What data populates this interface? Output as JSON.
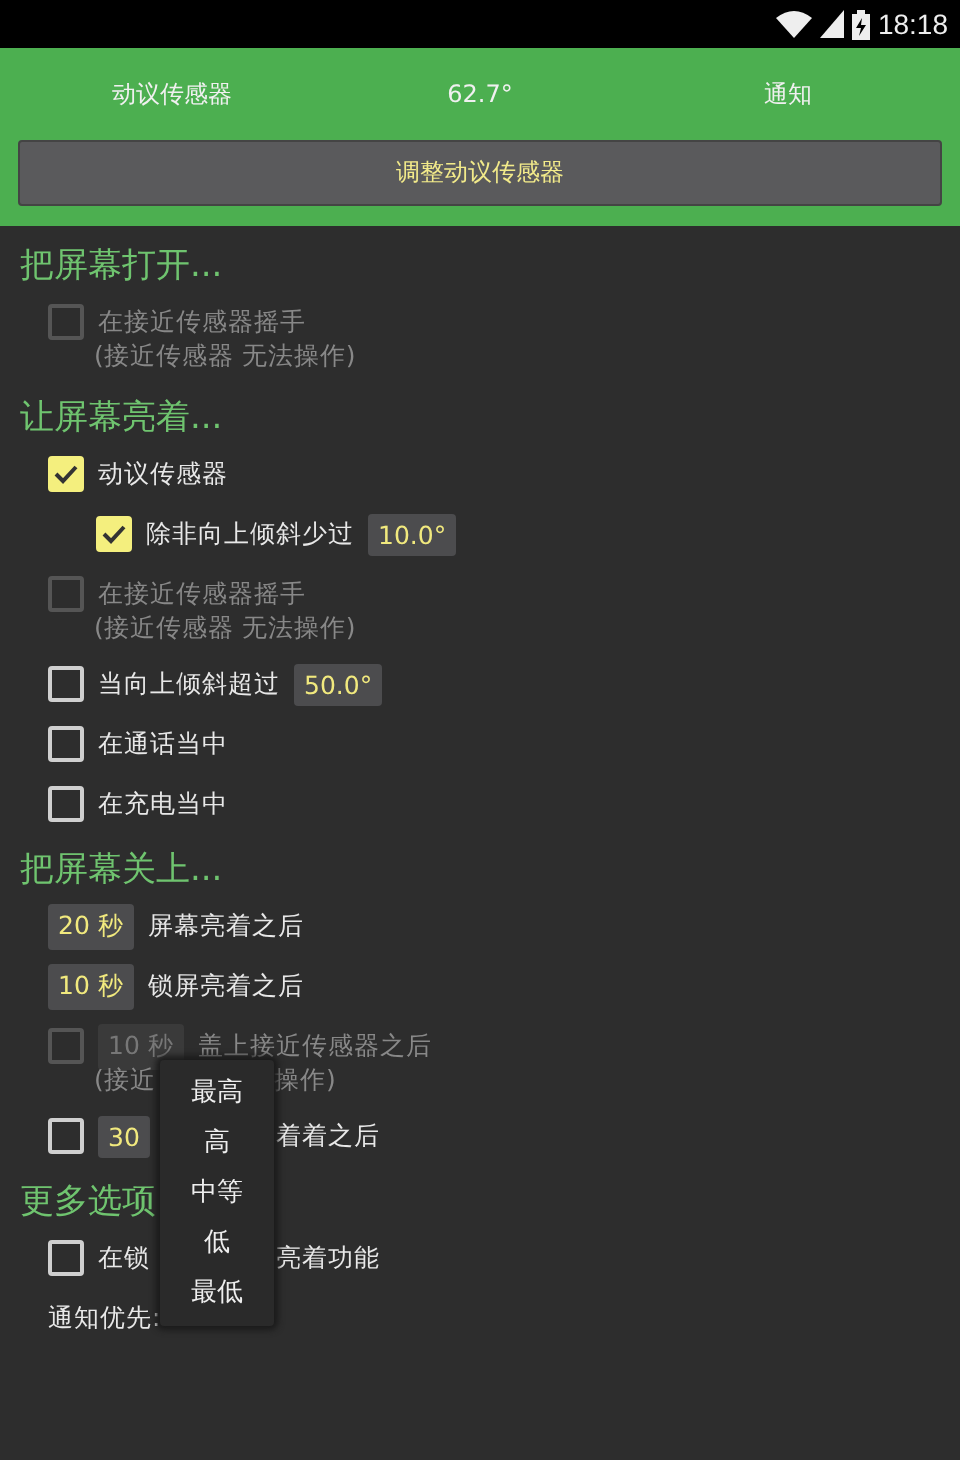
{
  "status_bar": {
    "time": "18:18"
  },
  "header": {
    "items": [
      "动议传感器",
      "62.7°",
      "通知"
    ],
    "button": "调整动议传感器"
  },
  "sections": [
    {
      "title": "把屏幕打开...",
      "rows": [
        {
          "kind": "check",
          "checked": false,
          "disabled": true,
          "label": "在接近传感器摇手",
          "sub": "(接近传感器 无法操作)"
        }
      ]
    },
    {
      "title": "让屏幕亮着...",
      "rows": [
        {
          "kind": "check",
          "checked": true,
          "disabled": false,
          "label": "动议传感器"
        },
        {
          "kind": "check",
          "checked": true,
          "disabled": false,
          "nested": true,
          "label": "除非向上倾斜少过",
          "value": "10.0°"
        },
        {
          "kind": "check",
          "checked": false,
          "disabled": true,
          "label": "在接近传感器摇手",
          "sub": "(接近传感器 无法操作)"
        },
        {
          "kind": "check",
          "checked": false,
          "disabled": false,
          "label": "当向上倾斜超过",
          "value": "50.0°"
        },
        {
          "kind": "check",
          "checked": false,
          "disabled": false,
          "label": "在通话当中"
        },
        {
          "kind": "check",
          "checked": false,
          "disabled": false,
          "label": "在充电当中"
        }
      ]
    },
    {
      "title": "把屏幕关上...",
      "rows": [
        {
          "kind": "timer",
          "value": "20 秒",
          "label": "屏幕亮着之后"
        },
        {
          "kind": "timer",
          "value": "10 秒",
          "label": "锁屏亮着之后"
        },
        {
          "kind": "check",
          "checked": false,
          "disabled": true,
          "value": "10 秒",
          "label": "盖上接近传感器之后",
          "sub": "(接近",
          "sub_right": "操作)"
        },
        {
          "kind": "check",
          "checked": false,
          "disabled": false,
          "value": "30",
          "label_right": "着着之后"
        }
      ]
    },
    {
      "title": "更多选项",
      "rows": [
        {
          "kind": "check",
          "checked": false,
          "disabled": false,
          "label": "在锁",
          "label_right": "亮着功能"
        },
        {
          "kind": "text",
          "label": "通知优先:"
        }
      ]
    }
  ],
  "menu": {
    "items": [
      "最高",
      "高",
      "中等",
      "低",
      "最低"
    ]
  }
}
